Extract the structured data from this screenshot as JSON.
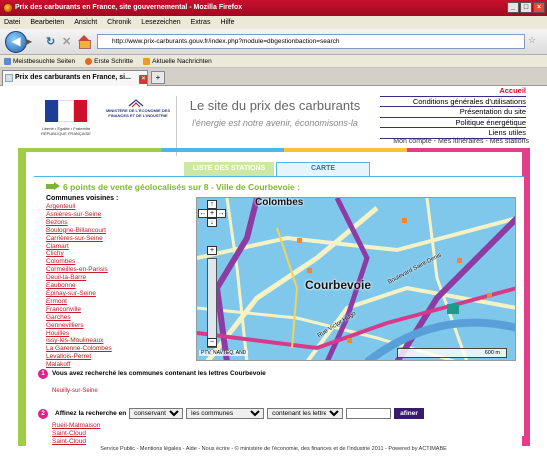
{
  "window": {
    "title": "Prix des carburants en France, site gouvernemental - Mozilla Firefox"
  },
  "menu": [
    "Datei",
    "Bearbeiten",
    "Ansicht",
    "Chronik",
    "Lesezeichen",
    "Extras",
    "Hilfe"
  ],
  "url": "http://www.prix-carburants.gouv.fr/index.php?module=dbgestionbaction=search",
  "bookmarks": [
    "Meistbesuchte Seiten",
    "Erste Schritte",
    "Aktuelle Nachrichten"
  ],
  "tab": {
    "title": "Prix des carburants en France, si..."
  },
  "header": {
    "rf_text": "Liberté • Égalité • Fraternité RÉPUBLIQUE FRANÇAISE",
    "ministry": "MINISTÈRE DE L'ÉCONOMIE DES FINANCES ET DE L'INDUSTRIE",
    "title": "Le site du prix des carburants",
    "tagline": "l'énergie est notre avenir, économisons-la"
  },
  "nav": {
    "items": [
      "Accueil",
      "Conditions générales d'utilisations",
      "Présentation du site",
      "Politique énergétique",
      "Liens utiles"
    ],
    "account": "Mon compte - Mes itinéraires - Mes stations"
  },
  "tabs": {
    "list": "LISTE DES STATIONS",
    "map": "CARTE"
  },
  "headline": "6 points de vente géolocalisés sur 8 - Ville de Courbevoie :",
  "communes": {
    "title": "Communes voisines :",
    "items": [
      "Argenteuil",
      "Asnières-sur-Seine",
      "Bezons",
      "Boulogne-Billancourt",
      "Carrières-sur-Seine",
      "Clamart",
      "Clichy",
      "Colombes",
      "Cormeilles-en-Parisis",
      "Deuil-la-Barre",
      "Eaubonne",
      "Épinay-sur-Seine",
      "Ermont",
      "Franconville",
      "Garches",
      "Gennevilliers",
      "Houilles",
      "Issy-les-Moulineaux",
      "La Garenne-Colombes",
      "Levallois-Perret",
      "Malakoff"
    ]
  },
  "map": {
    "cities": [
      "Colombes",
      "Courbevoie"
    ],
    "streets": [
      "Boulevard Saint-Denis",
      "Rue Victor Hugo"
    ],
    "copyright": "PTV, NAVTEQ, AND",
    "scale": "600 m"
  },
  "step1": {
    "num": "1",
    "text": "Vous avez recherché les communes contenant les lettres Courbevoie",
    "result": "Neuilly-sur-Seine"
  },
  "step2": {
    "num": "2",
    "label": "Affinez la recherche en",
    "sel1": "conservant",
    "sel2": "les communes",
    "sel3": "contenant les lettres",
    "button": "afiner",
    "results": [
      "Rueil-Malmaison",
      "Saint-Cloud",
      "Saint-Cloud"
    ]
  },
  "footer": "Service Public - Mentions légales - Aide - Nous écrire - © ministère de l'économie, des finances et de l'industrie 2011 - Powered by ACTIMABE",
  "colors": {
    "accent_red": "#d0112b",
    "green": "#7fb536",
    "pink": "#e33e8a",
    "blue": "#4fb6e6",
    "yellow": "#f6c33a"
  }
}
